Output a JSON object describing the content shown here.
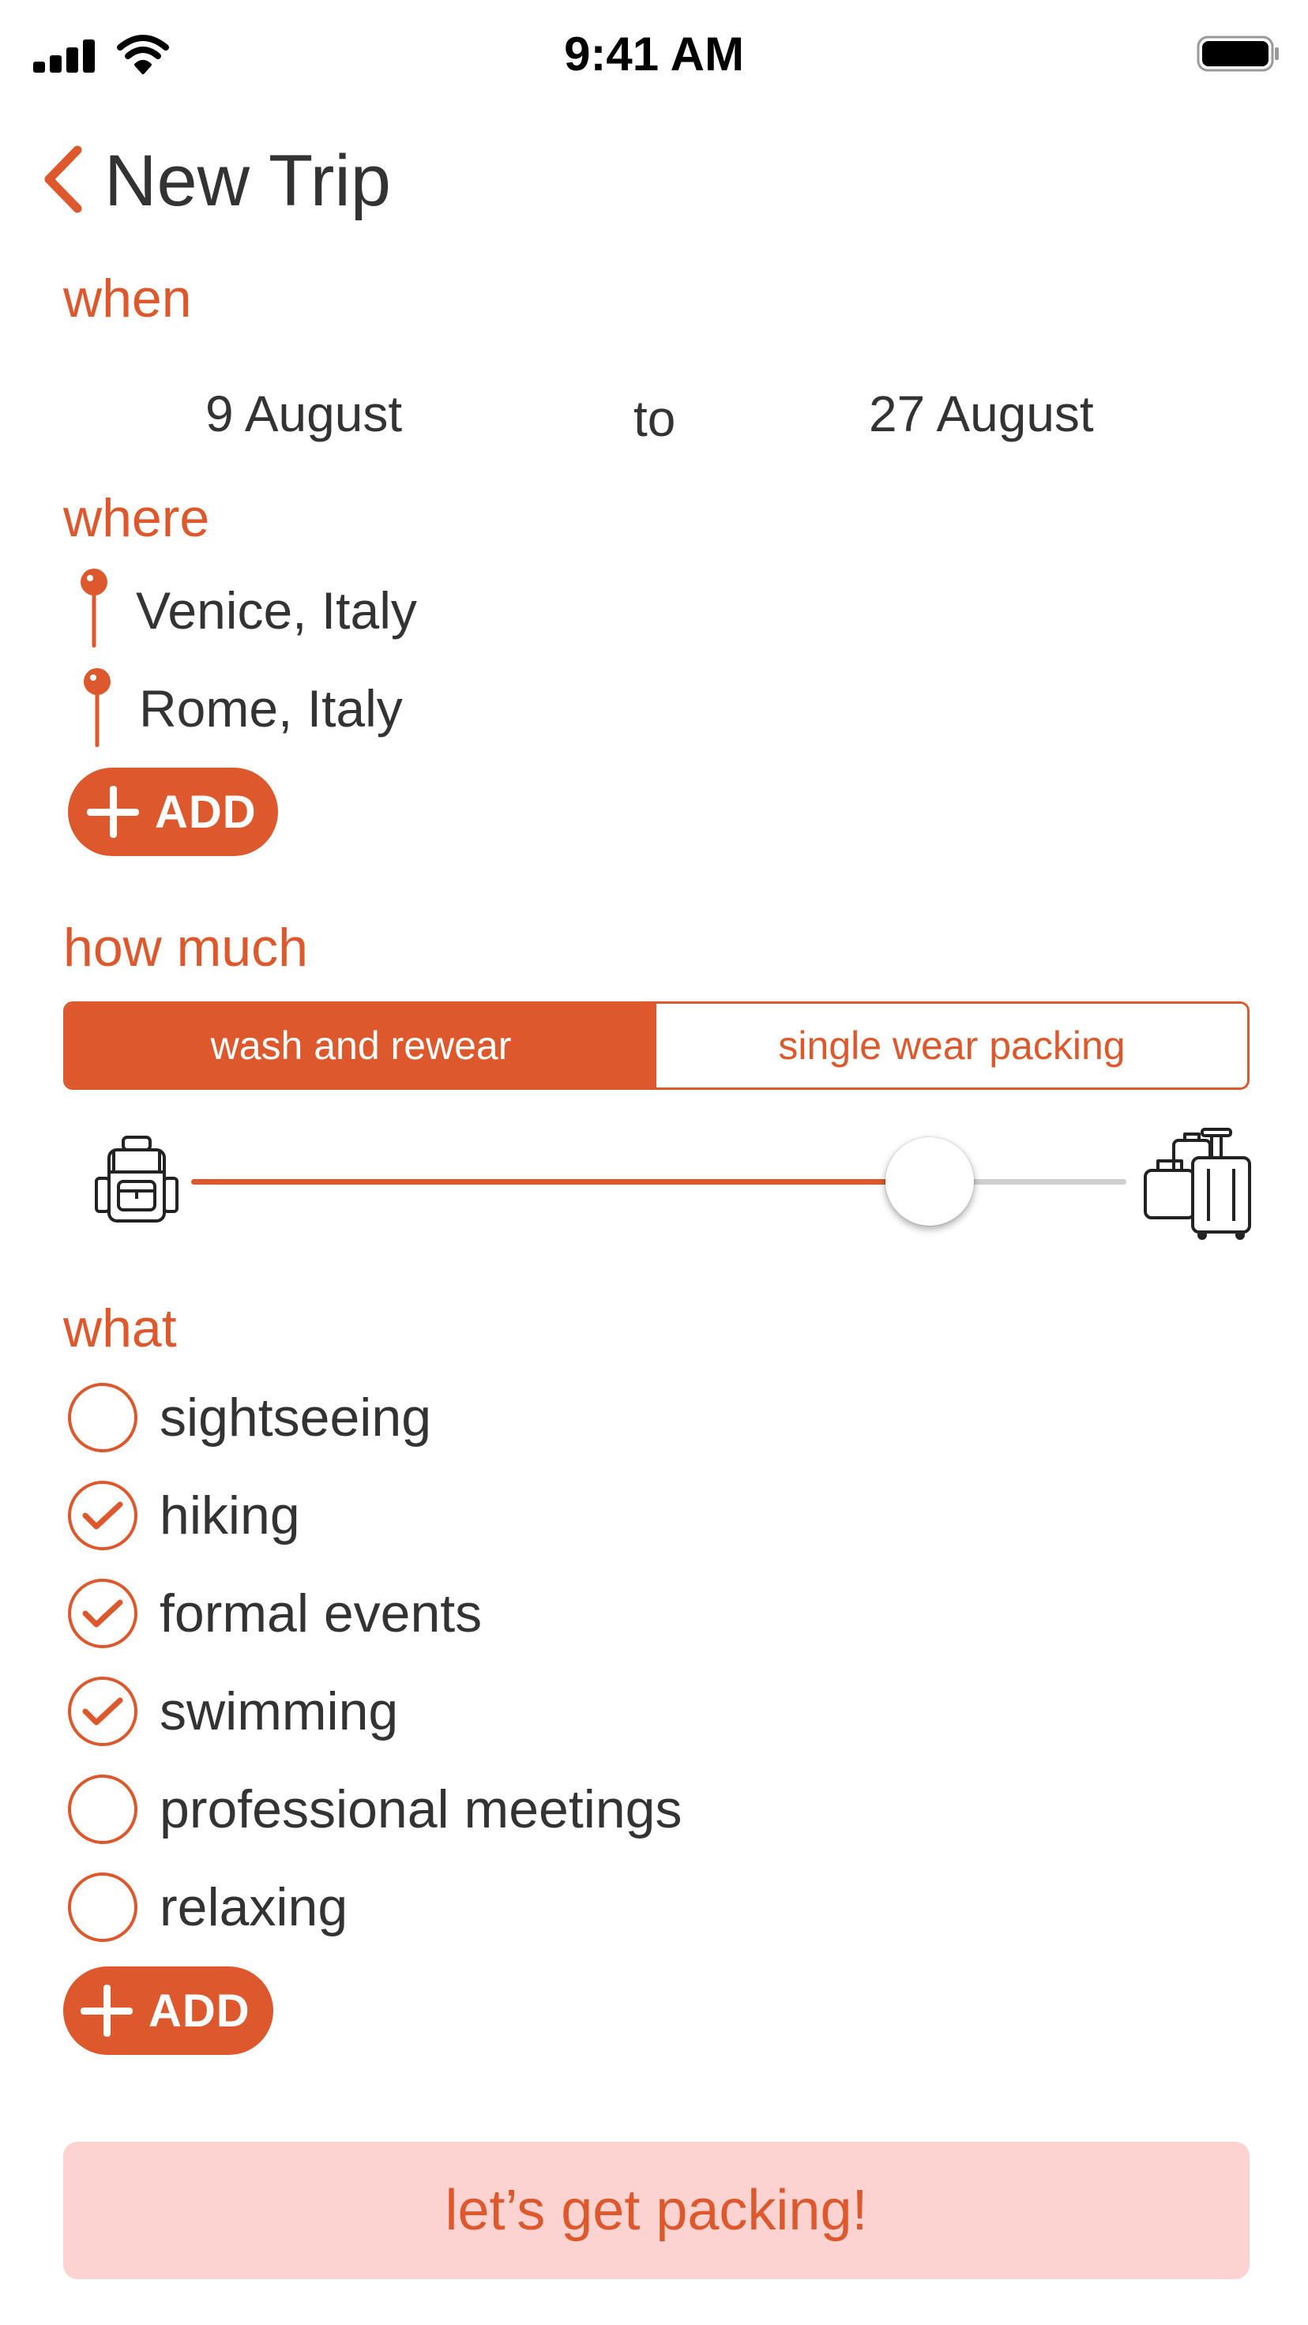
{
  "colors": {
    "accent": "#dd582d",
    "cta_background": "#fdd3d2",
    "text": "#333333"
  },
  "status_bar": {
    "time": "9:41 AM"
  },
  "header": {
    "title": "New Trip"
  },
  "when": {
    "label": "when",
    "start_date": "9 August",
    "separator": "to",
    "end_date": "27 August"
  },
  "where": {
    "label": "where",
    "places": [
      {
        "name": "Venice, Italy",
        "icon": "map-pin-icon"
      },
      {
        "name": "Rome, Italy",
        "icon": "map-pin-icon"
      }
    ],
    "add_label": "ADD"
  },
  "how_much": {
    "label": "how much",
    "options": [
      "wash and rewear",
      "single wear packing"
    ],
    "selected_option": "wash and rewear",
    "slider_level": 0.79,
    "slider_min_icon": "backpack-icon",
    "slider_max_icon": "luggage-icon"
  },
  "what": {
    "label": "what",
    "items": [
      {
        "label": "sightseeing",
        "checked": false
      },
      {
        "label": "hiking",
        "checked": true
      },
      {
        "label": "formal events",
        "checked": true
      },
      {
        "label": "swimming",
        "checked": true
      },
      {
        "label": "professional meetings",
        "checked": false
      },
      {
        "label": "relaxing",
        "checked": false
      }
    ],
    "add_label": "ADD"
  },
  "cta": {
    "label": "let’s get packing!"
  }
}
